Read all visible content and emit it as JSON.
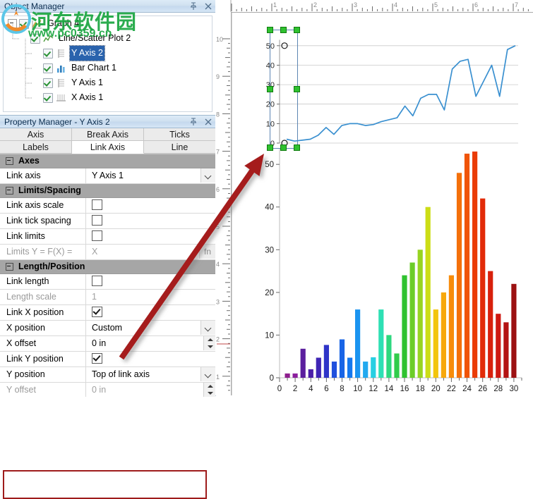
{
  "object_manager": {
    "title": "Object Manager",
    "pin_icon": "pin-icon",
    "close_icon": "close-icon",
    "items": [
      {
        "label": "Graph 4",
        "icon": "graph-icon",
        "depth": 0,
        "checked": true,
        "selected": false,
        "expander": true
      },
      {
        "label": "Line/Scatter Plot 2",
        "icon": "line-scatter-icon",
        "depth": 1,
        "checked": true,
        "selected": false,
        "expander": false
      },
      {
        "label": "Y Axis 2",
        "icon": "y-axis-icon",
        "depth": 2,
        "checked": true,
        "selected": true,
        "expander": false
      },
      {
        "label": "Bar Chart 1",
        "icon": "bar-chart-icon",
        "depth": 2,
        "checked": true,
        "selected": false,
        "expander": false
      },
      {
        "label": "Y Axis 1",
        "icon": "y-axis-icon",
        "depth": 2,
        "checked": true,
        "selected": false,
        "expander": false
      },
      {
        "label": "X Axis 1",
        "icon": "x-axis-icon",
        "depth": 2,
        "checked": true,
        "selected": false,
        "expander": false
      }
    ]
  },
  "property_manager": {
    "title": "Property Manager - Y Axis 2",
    "pin_icon": "pin-icon",
    "close_icon": "close-icon",
    "tabs_row1": [
      {
        "label": "Axis",
        "active": false
      },
      {
        "label": "Break Axis",
        "active": false
      },
      {
        "label": "Ticks",
        "active": false
      }
    ],
    "tabs_row2": [
      {
        "label": "Labels",
        "active": false
      },
      {
        "label": "Link Axis",
        "active": true
      },
      {
        "label": "Line",
        "active": false
      }
    ],
    "groups": [
      {
        "name": "Axes",
        "rows": [
          {
            "label": "Link axis",
            "value": "Y Axis 1",
            "type": "combo",
            "dim": false
          }
        ]
      },
      {
        "name": "Limits/Spacing",
        "rows": [
          {
            "label": "Link axis scale",
            "value": "",
            "type": "checkbox",
            "checked": false,
            "dim": false
          },
          {
            "label": "Link tick spacing",
            "value": "",
            "type": "checkbox",
            "checked": false,
            "dim": false
          },
          {
            "label": "Link limits",
            "value": "",
            "type": "checkbox",
            "checked": false,
            "dim": false
          },
          {
            "label": "Limits Y = F(X) =",
            "value": "X",
            "type": "fn",
            "dim": true
          }
        ]
      },
      {
        "name": "Length/Position",
        "rows": [
          {
            "label": "Link length",
            "value": "",
            "type": "checkbox",
            "checked": false,
            "dim": false
          },
          {
            "label": "Length scale",
            "value": "1",
            "type": "text",
            "dim": true
          },
          {
            "label": "Link X position",
            "value": "",
            "type": "checkbox",
            "checked": true,
            "dim": false
          },
          {
            "label": "X position",
            "value": "Custom",
            "type": "combo",
            "dim": false
          },
          {
            "label": "X offset",
            "value": "0 in",
            "type": "spin",
            "dim": false
          },
          {
            "label": "Link Y position",
            "value": "",
            "type": "checkbox",
            "checked": true,
            "dim": false
          },
          {
            "label": "Y position",
            "value": "Top of link axis",
            "type": "combo",
            "dim": false
          },
          {
            "label": "Y offset",
            "value": "0 in",
            "type": "spin",
            "dim": true
          }
        ]
      }
    ],
    "highlight_color": "#9e1b1b"
  },
  "rulers": {
    "horizontal_ticks": [
      "1",
      "2",
      "3",
      "4",
      "5",
      "6",
      "7"
    ],
    "vertical_ticks": [
      "10",
      "9",
      "8",
      "7",
      "6",
      "5",
      "4",
      "3",
      "2",
      "1"
    ],
    "units": "in"
  },
  "annotation": {
    "arrow_color": "#a51f1f",
    "from": "Y position property row",
    "to": "Y Axis 2 selection on canvas"
  },
  "watermark": {
    "text_cn": "河东软件园",
    "url": "www.pc0359.cn",
    "color": "#1aa640"
  },
  "chart_data": [
    {
      "type": "bar",
      "title": "",
      "xlabel": "",
      "ylabel": "",
      "xlim": [
        0,
        31
      ],
      "ylim": [
        0,
        53
      ],
      "xticks": [
        "0",
        "2",
        "4",
        "6",
        "8",
        "10",
        "12",
        "14",
        "16",
        "18",
        "20",
        "22",
        "24",
        "26",
        "28",
        "30"
      ],
      "yticks": [
        "0",
        "10",
        "20",
        "30",
        "40",
        "50"
      ],
      "grid": false,
      "categories": [
        1,
        2,
        3,
        4,
        5,
        6,
        7,
        8,
        9,
        10,
        11,
        12,
        13,
        14,
        15,
        16,
        17,
        18,
        19,
        20,
        21,
        22,
        23,
        24,
        25,
        26,
        27,
        28,
        29,
        30
      ],
      "values": [
        1,
        1,
        6.8,
        2,
        4.7,
        7.7,
        3.8,
        9,
        4.7,
        16,
        3.8,
        4.8,
        16,
        10,
        5.7,
        24,
        27,
        30,
        40,
        16,
        20,
        24,
        48,
        52.5,
        53,
        42,
        25,
        15,
        13,
        22
      ],
      "colors": [
        "#8e1f8e",
        "#8b1f9e",
        "#5b1f9e",
        "#4b1fa8",
        "#3f25b5",
        "#2f35c8",
        "#2050dd",
        "#1864e6",
        "#1578ee",
        "#1b94f0",
        "#22a9ef",
        "#28cfe2",
        "#2ee0b4",
        "#2ed87f",
        "#31cc4b",
        "#2fc22f",
        "#6ccd28",
        "#97d421",
        "#ccdd16",
        "#f2c50d",
        "#f7a80c",
        "#f78c0b",
        "#f4700a",
        "#f05408",
        "#ea3c07",
        "#e22b08",
        "#d8200c",
        "#ce1811",
        "#b41313",
        "#9c1112"
      ]
    },
    {
      "type": "line",
      "title": "",
      "xlabel": "",
      "ylabel": "",
      "series_name": "Line/Scatter Plot 2",
      "color": "#3a90d0",
      "ylim": [
        0,
        55
      ],
      "yticks": [
        "0",
        "10",
        "20",
        "30",
        "40",
        "50"
      ],
      "grid": true,
      "x": [
        1,
        2,
        3,
        4,
        5,
        6,
        7,
        8,
        9,
        10,
        11,
        12,
        13,
        14,
        15,
        16,
        17,
        18,
        19,
        20,
        21,
        22,
        23,
        24,
        25,
        26,
        27,
        28,
        29,
        30
      ],
      "values": [
        2,
        1,
        1.5,
        2,
        4,
        8,
        4.5,
        9,
        10,
        10,
        9,
        9.5,
        11,
        12,
        13,
        19,
        14,
        23,
        25,
        25,
        17,
        38,
        42,
        43,
        24,
        32,
        40,
        24,
        48,
        50
      ]
    }
  ]
}
